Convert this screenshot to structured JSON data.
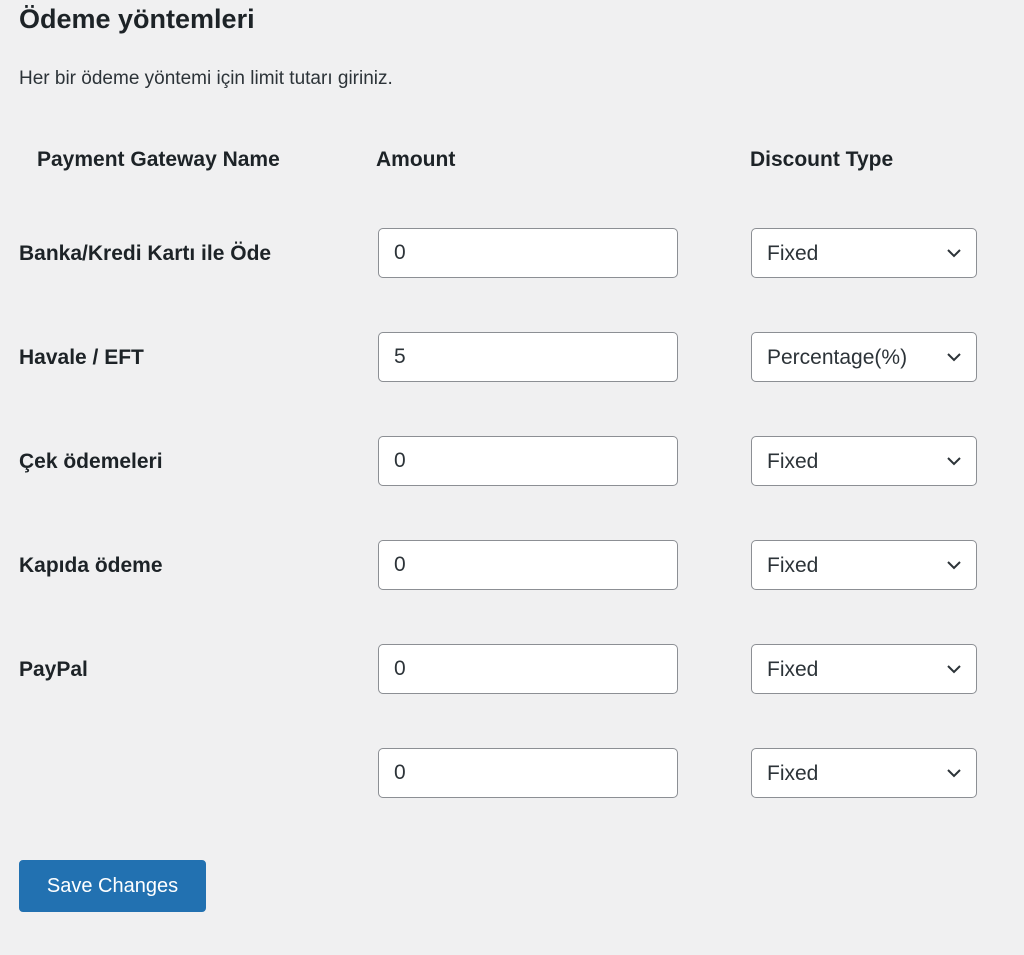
{
  "section": {
    "title": "Ödeme yöntemleri",
    "description": "Her bir ödeme yöntemi için limit tutarı giriniz."
  },
  "table": {
    "headers": {
      "name": "Payment Gateway Name",
      "amount": "Amount",
      "discount_type": "Discount Type"
    },
    "rows": [
      {
        "name": "Banka/Kredi Kartı ile Öde",
        "amount": "0",
        "discount_type": "Fixed"
      },
      {
        "name": "Havale / EFT",
        "amount": "5",
        "discount_type": "Percentage(%)"
      },
      {
        "name": "Çek ödemeleri",
        "amount": "0",
        "discount_type": "Fixed"
      },
      {
        "name": "Kapıda ödeme",
        "amount": "0",
        "discount_type": "Fixed"
      },
      {
        "name": "PayPal",
        "amount": "0",
        "discount_type": "Fixed"
      },
      {
        "name": "",
        "amount": "0",
        "discount_type": "Fixed"
      }
    ]
  },
  "icons": {
    "select_arrow": "chevron-down-icon"
  },
  "colors": {
    "background": "#f0f0f1",
    "primary_button": "#2271b1",
    "input_border": "#8c8f94",
    "text": "#1d2327"
  },
  "actions": {
    "save_label": "Save Changes"
  }
}
